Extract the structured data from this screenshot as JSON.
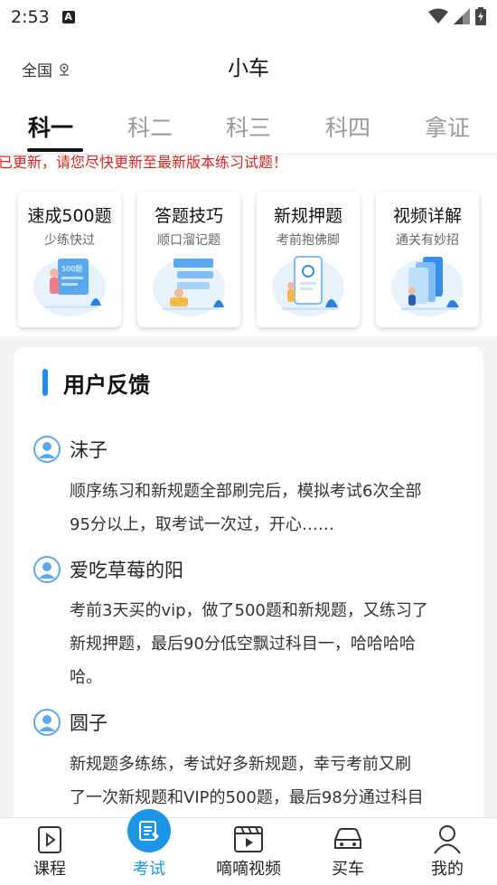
{
  "status_bar": {
    "time": "2:53"
  },
  "header": {
    "region": "全国",
    "title": "小车"
  },
  "tabs": [
    {
      "label": "科一",
      "active": true
    },
    {
      "label": "科二",
      "active": false
    },
    {
      "label": "科三",
      "active": false
    },
    {
      "label": "科四",
      "active": false
    },
    {
      "label": "拿证",
      "active": false
    }
  ],
  "notice": "库已更新，请您尽快更新至最新版本练习试题！",
  "cards": [
    {
      "title": "速成500题",
      "subtitle": "少练快过",
      "icon": "500-questions-illustration"
    },
    {
      "title": "答题技巧",
      "subtitle": "顺口溜记题",
      "icon": "study-illustration"
    },
    {
      "title": "新规押题",
      "subtitle": "考前抱佛脚",
      "icon": "phone-illustration"
    },
    {
      "title": "视频详解",
      "subtitle": "通关有妙招",
      "icon": "video-illustration"
    }
  ],
  "feedback": {
    "title": "用户反馈",
    "items": [
      {
        "name": "沫子",
        "text_lines": [
          "顺序练习和新规题全部刷完后，模拟考试6次全部",
          "95分以上，取考试一次过，开心……"
        ]
      },
      {
        "name": "爱吃草莓的阳",
        "text_lines": [
          "考前3天买的vip，做了500题和新规题，又练习了",
          "新规押题，最后90分低空飘过科目一，哈哈哈哈",
          "哈。"
        ]
      },
      {
        "name": "圆子",
        "text_lines": [
          "新规题多练练，考试好多新规题，幸亏考前又刷",
          "了一次新规题和VIP的500题，最后98分通过科目"
        ]
      }
    ]
  },
  "bottom_nav": [
    {
      "label": "课程",
      "icon": "course-icon",
      "active": false
    },
    {
      "label": "考试",
      "icon": "exam-icon",
      "active": true
    },
    {
      "label": "嘀嘀视频",
      "icon": "video-icon",
      "active": false
    },
    {
      "label": "买车",
      "icon": "car-icon",
      "active": false
    },
    {
      "label": "我的",
      "icon": "profile-icon",
      "active": false
    }
  ],
  "colors": {
    "accent": "#1a95e8",
    "notice": "#e0231c"
  }
}
